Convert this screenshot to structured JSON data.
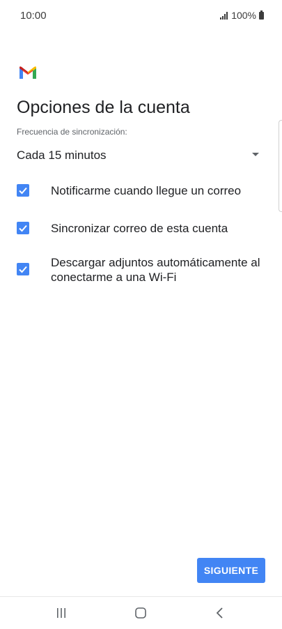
{
  "status_bar": {
    "time": "10:00",
    "battery": "100%"
  },
  "header": {
    "app_icon": "gmail-logo",
    "title": "Opciones de la cuenta"
  },
  "sync": {
    "label": "Frecuencia de sincronización:",
    "selected": "Cada 15 minutos"
  },
  "options": [
    {
      "label": "Notificarme cuando llegue un correo",
      "checked": true
    },
    {
      "label": "Sincronizar correo de esta cuenta",
      "checked": true
    },
    {
      "label": "Descargar adjuntos automáticamente al conectarme a una Wi-Fi",
      "checked": true
    }
  ],
  "actions": {
    "next_label": "SIGUIENTE"
  },
  "colors": {
    "accent": "#4285f4"
  },
  "nav": {
    "icons": [
      "recents-icon",
      "home-icon",
      "back-icon"
    ]
  }
}
